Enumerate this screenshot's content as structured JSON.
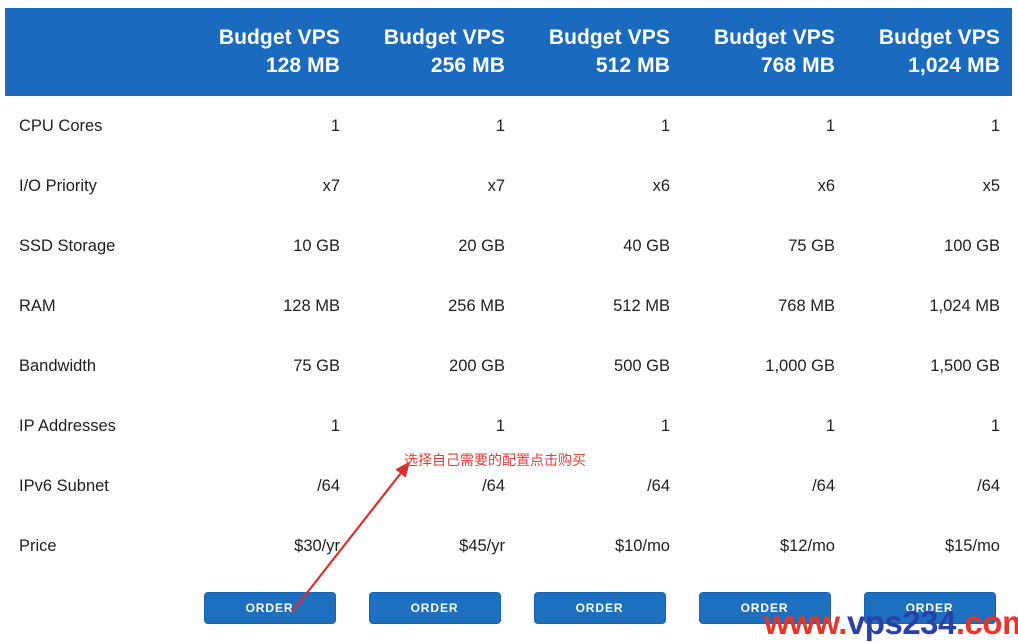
{
  "table": {
    "plans": [
      {
        "name": "Budget VPS",
        "size": "128 MB"
      },
      {
        "name": "Budget VPS",
        "size": "256 MB"
      },
      {
        "name": "Budget VPS",
        "size": "512 MB"
      },
      {
        "name": "Budget VPS",
        "size": "768 MB"
      },
      {
        "name": "Budget VPS",
        "size": "1,024 MB"
      }
    ],
    "rows": [
      {
        "label": "CPU Cores",
        "values": [
          "1",
          "1",
          "1",
          "1",
          "1"
        ]
      },
      {
        "label": "I/O Priority",
        "values": [
          "x7",
          "x7",
          "x6",
          "x6",
          "x5"
        ]
      },
      {
        "label": "SSD Storage",
        "values": [
          "10 GB",
          "20 GB",
          "40 GB",
          "75 GB",
          "100 GB"
        ]
      },
      {
        "label": "RAM",
        "values": [
          "128 MB",
          "256 MB",
          "512 MB",
          "768 MB",
          "1,024 MB"
        ]
      },
      {
        "label": "Bandwidth",
        "values": [
          "75 GB",
          "200 GB",
          "500 GB",
          "1,000 GB",
          "1,500 GB"
        ]
      },
      {
        "label": "IP Addresses",
        "values": [
          "1",
          "1",
          "1",
          "1",
          "1"
        ]
      },
      {
        "label": "IPv6 Subnet",
        "values": [
          "/64",
          "/64",
          "/64",
          "/64",
          "/64"
        ]
      },
      {
        "label": "Price",
        "values": [
          "$30/yr",
          "$45/yr",
          "$10/mo",
          "$12/mo",
          "$15/mo"
        ]
      }
    ],
    "order_labels": [
      "ORDER",
      "ORDER",
      "ORDER",
      "ORDER",
      "ORDER"
    ]
  },
  "annotation": {
    "text": "选择自己需要的配置点击购买",
    "color": "#e0413a"
  },
  "watermark": {
    "part1": "www.",
    "part2": "vps234",
    "part3": ".com",
    "color_red": "#e8352b",
    "color_blue": "#2a3fa8"
  },
  "colors": {
    "header_blue": "#1a6bc0",
    "button_blue": "#1d6fc0",
    "text_dark": "#1f1f1f",
    "white": "#ffffff"
  }
}
